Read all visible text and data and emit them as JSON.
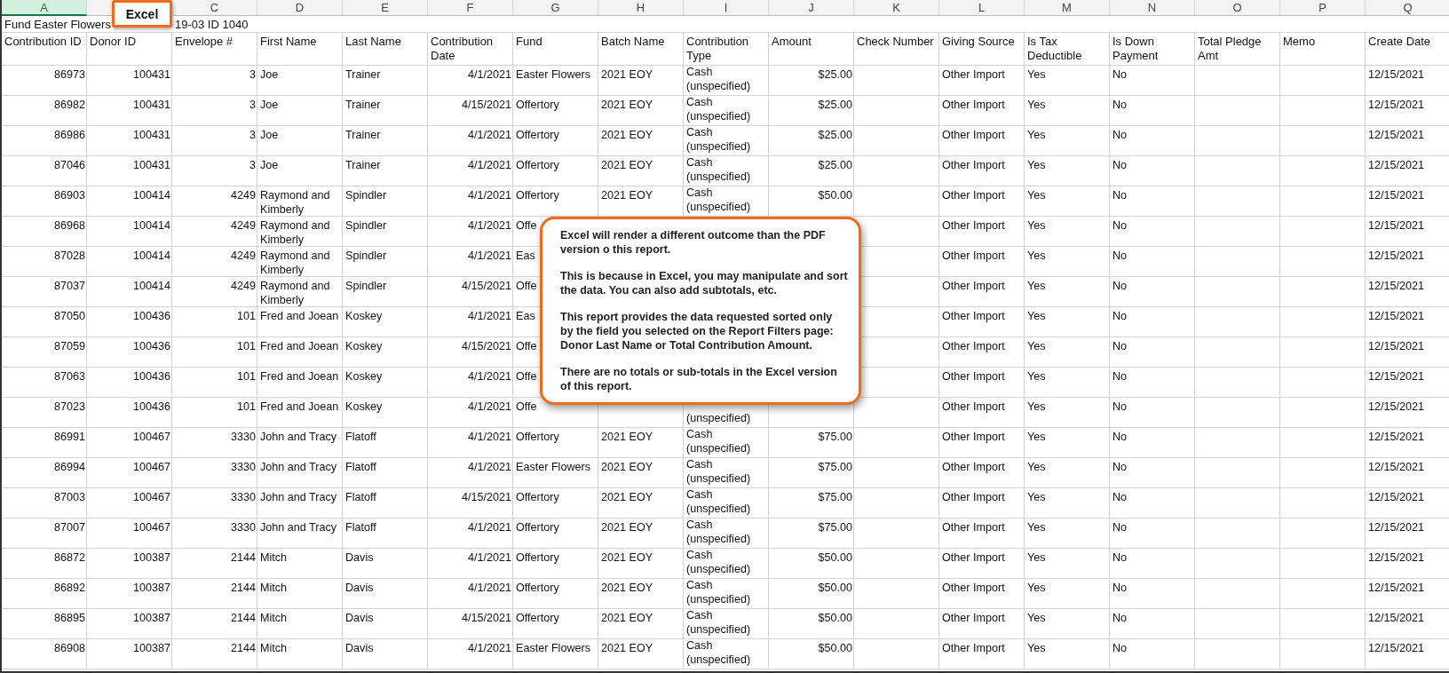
{
  "column_letters": [
    {
      "label": "A",
      "selected": true
    },
    {
      "selected": false
    },
    {
      "label": "C",
      "selected": false
    },
    {
      "label": "D",
      "selected": false
    },
    {
      "label": "E",
      "selected": false
    },
    {
      "label": "F",
      "selected": false
    },
    {
      "label": "G",
      "selected": false
    },
    {
      "label": "H",
      "selected": false
    },
    {
      "label": "I",
      "selected": false
    },
    {
      "label": "J",
      "selected": false
    },
    {
      "label": "K",
      "selected": false
    },
    {
      "label": "L",
      "selected": false
    },
    {
      "label": "M",
      "selected": false
    },
    {
      "label": "N",
      "selected": false
    },
    {
      "label": "O",
      "selected": false
    },
    {
      "label": "P",
      "selected": false
    },
    {
      "label": "Q",
      "selected": false
    }
  ],
  "title_row": [
    "Fund Easter Flowers",
    "19-03  ID 1040"
  ],
  "badge": "Excel",
  "headers": [
    "Contribution ID",
    "Donor ID",
    "Envelope #",
    "First Name",
    "Last Name",
    "Contribution Date",
    "Fund",
    "Batch Name",
    "Contribution Type",
    "Amount",
    "Check Number",
    "Giving Source",
    "Is Tax Deductible",
    "Is Down Payment",
    "Total Pledge Amt",
    "Memo",
    "Create Date"
  ],
  "rows": [
    [
      "86973",
      "100431",
      "3",
      "Joe",
      "Trainer",
      "4/1/2021",
      "Easter Flowers",
      "2021 EOY",
      "Cash (unspecified)",
      "$25.00",
      null,
      "Other Import",
      "Yes",
      "No",
      null,
      null,
      "12/15/2021"
    ],
    [
      "86982",
      "100431",
      "3",
      "Joe",
      "Trainer",
      "4/15/2021",
      "Offertory",
      "2021 EOY",
      "Cash (unspecified)",
      "$25.00",
      null,
      "Other Import",
      "Yes",
      "No",
      null,
      null,
      "12/15/2021"
    ],
    [
      "86986",
      "100431",
      "3",
      "Joe",
      "Trainer",
      "4/1/2021",
      "Offertory",
      "2021 EOY",
      "Cash (unspecified)",
      "$25.00",
      null,
      "Other Import",
      "Yes",
      "No",
      null,
      null,
      "12/15/2021"
    ],
    [
      "87046",
      "100431",
      "3",
      "Joe",
      "Trainer",
      "4/1/2021",
      "Offertory",
      "2021 EOY",
      "Cash (unspecified)",
      "$25.00",
      null,
      "Other Import",
      "Yes",
      "No",
      null,
      null,
      "12/15/2021"
    ],
    [
      "86903",
      "100414",
      "4249",
      "Raymond and Kimberly",
      "Spindler",
      "4/1/2021",
      "Offertory",
      "2021 EOY",
      "Cash (unspecified)",
      "$50.00",
      null,
      "Other Import",
      "Yes",
      "No",
      null,
      null,
      "12/15/2021"
    ],
    [
      "86968",
      "100414",
      "4249",
      "Raymond and Kimberly",
      "Spindler",
      "4/1/2021",
      "Offe",
      null,
      null,
      null,
      null,
      "Other Import",
      "Yes",
      "No",
      null,
      null,
      "12/15/2021"
    ],
    [
      "87028",
      "100414",
      "4249",
      "Raymond and Kimberly",
      "Spindler",
      "4/1/2021",
      "Eas",
      null,
      null,
      null,
      null,
      "Other Import",
      "Yes",
      "No",
      null,
      null,
      "12/15/2021"
    ],
    [
      "87037",
      "100414",
      "4249",
      "Raymond and Kimberly",
      "Spindler",
      "4/15/2021",
      "Offe",
      null,
      null,
      null,
      null,
      "Other Import",
      "Yes",
      "No",
      null,
      null,
      "12/15/2021"
    ],
    [
      "87050",
      "100436",
      "101",
      "Fred and Joean",
      "Koskey",
      "4/1/2021",
      "Eas",
      null,
      null,
      null,
      null,
      "Other Import",
      "Yes",
      "No",
      null,
      null,
      "12/15/2021"
    ],
    [
      "87059",
      "100436",
      "101",
      "Fred and Joean",
      "Koskey",
      "4/15/2021",
      "Offe",
      null,
      null,
      null,
      null,
      "Other Import",
      "Yes",
      "No",
      null,
      null,
      "12/15/2021"
    ],
    [
      "87063",
      "100436",
      "101",
      "Fred and Joean",
      "Koskey",
      "4/1/2021",
      "Offe",
      null,
      null,
      null,
      null,
      "Other Import",
      "Yes",
      "No",
      null,
      null,
      "12/15/2021"
    ],
    [
      "87023",
      "100436",
      "101",
      "Fred and Joean",
      "Koskey",
      "4/1/2021",
      "Offe",
      null,
      "(unspecified)",
      null,
      null,
      "Other Import",
      "Yes",
      "No",
      null,
      null,
      "12/15/2021"
    ],
    [
      "86991",
      "100467",
      "3330",
      "John and Tracy",
      "Flatoff",
      "4/1/2021",
      "Offertory",
      "2021 EOY",
      "Cash (unspecified)",
      "$75.00",
      null,
      "Other Import",
      "Yes",
      "No",
      null,
      null,
      "12/15/2021"
    ],
    [
      "86994",
      "100467",
      "3330",
      "John and Tracy",
      "Flatoff",
      "4/1/2021",
      "Easter Flowers",
      "2021 EOY",
      "Cash (unspecified)",
      "$75.00",
      null,
      "Other Import",
      "Yes",
      "No",
      null,
      null,
      "12/15/2021"
    ],
    [
      "87003",
      "100467",
      "3330",
      "John and Tracy",
      "Flatoff",
      "4/15/2021",
      "Offertory",
      "2021 EOY",
      "Cash (unspecified)",
      "$75.00",
      null,
      "Other Import",
      "Yes",
      "No",
      null,
      null,
      "12/15/2021"
    ],
    [
      "87007",
      "100467",
      "3330",
      "John and Tracy",
      "Flatoff",
      "4/1/2021",
      "Offertory",
      "2021 EOY",
      "Cash (unspecified)",
      "$75.00",
      null,
      "Other Import",
      "Yes",
      "No",
      null,
      null,
      "12/15/2021"
    ],
    [
      "86872",
      "100387",
      "2144",
      "Mitch",
      "Davis",
      "4/1/2021",
      "Offertory",
      "2021 EOY",
      "Cash (unspecified)",
      "$50.00",
      null,
      "Other Import",
      "Yes",
      "No",
      null,
      null,
      "12/15/2021"
    ],
    [
      "86892",
      "100387",
      "2144",
      "Mitch",
      "Davis",
      "4/1/2021",
      "Offertory",
      "2021 EOY",
      "Cash (unspecified)",
      "$50.00",
      null,
      "Other Import",
      "Yes",
      "No",
      null,
      null,
      "12/15/2021"
    ],
    [
      "86895",
      "100387",
      "2144",
      "Mitch",
      "Davis",
      "4/15/2021",
      "Offertory",
      "2021 EOY",
      "Cash (unspecified)",
      "$50.00",
      null,
      "Other Import",
      "Yes",
      "No",
      null,
      null,
      "12/15/2021"
    ],
    [
      "86908",
      "100387",
      "2144",
      "Mitch",
      "Davis",
      "4/1/2021",
      "Easter Flowers",
      "2021 EOY",
      "Cash (unspecified)",
      "$50.00",
      null,
      "Other Import",
      "Yes",
      "No",
      null,
      null,
      "12/15/2021"
    ]
  ],
  "callout": [
    "Excel will render a different outcome than the PDF version o this report.",
    "This is because in Excel, you may manipulate and sort the data. You can also add subtotals, etc.",
    "This report provides the data requested sorted only by the field you selected on the Report Filters page: Donor Last Name or Total Contribution Amount.",
    "There are no totals or sub-totals in the Excel version of this report."
  ]
}
